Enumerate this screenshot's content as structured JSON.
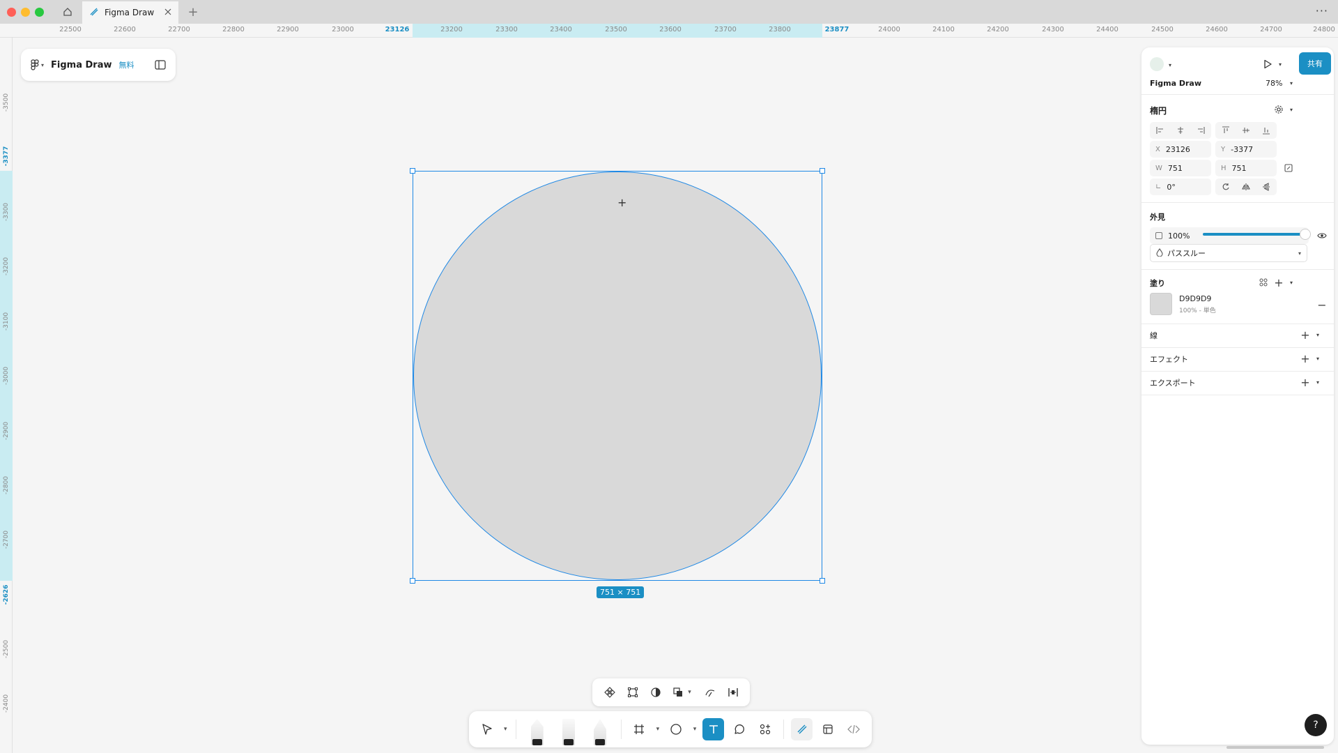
{
  "window": {
    "tab_title": "Figma Draw",
    "new_tab": "+",
    "more": "···"
  },
  "ruler": {
    "top_ticks": [
      "22500",
      "22600",
      "22700",
      "22800",
      "22900",
      "23000",
      "23126",
      "23200",
      "23300",
      "23400",
      "23500",
      "23600",
      "23700",
      "23800",
      "23877",
      "24000",
      "24100",
      "24200",
      "24300",
      "24400",
      "24500",
      "24600",
      "24700",
      "24800"
    ],
    "left_ticks": [
      "-3500",
      "-3377",
      "-3300",
      "-3200",
      "-3100",
      "-3000",
      "-2900",
      "-2800",
      "-2700",
      "-2626",
      "-2500",
      "-2400"
    ]
  },
  "file": {
    "name": "Figma Draw",
    "plan": "無料"
  },
  "selection": {
    "size_label": "751 × 751",
    "fill_color": "#d9d9d9",
    "stroke_color": "#1e88e5"
  },
  "panel": {
    "file_name": "Figma Draw",
    "zoom": "78%",
    "share_label": "共有",
    "layer_title": "楕円",
    "x_label": "X",
    "x_value": "23126",
    "y_label": "Y",
    "y_value": "-3377",
    "w_label": "W",
    "w_value": "751",
    "h_label": "H",
    "h_value": "751",
    "rotation": "0°",
    "appearance_title": "外見",
    "opacity": "100%",
    "blend_mode": "パススルー",
    "fill_title": "塗り",
    "fill_hex": "D9D9D9",
    "fill_meta": "100% - 単色",
    "stroke_title": "線",
    "effects_title": "エフェクト",
    "export_title": "エクスポート"
  },
  "help": "?",
  "colors": {
    "accent": "#1b8fc4",
    "canvas": "#f5f5f5",
    "ruler_highlight": "#c9ecf2"
  }
}
